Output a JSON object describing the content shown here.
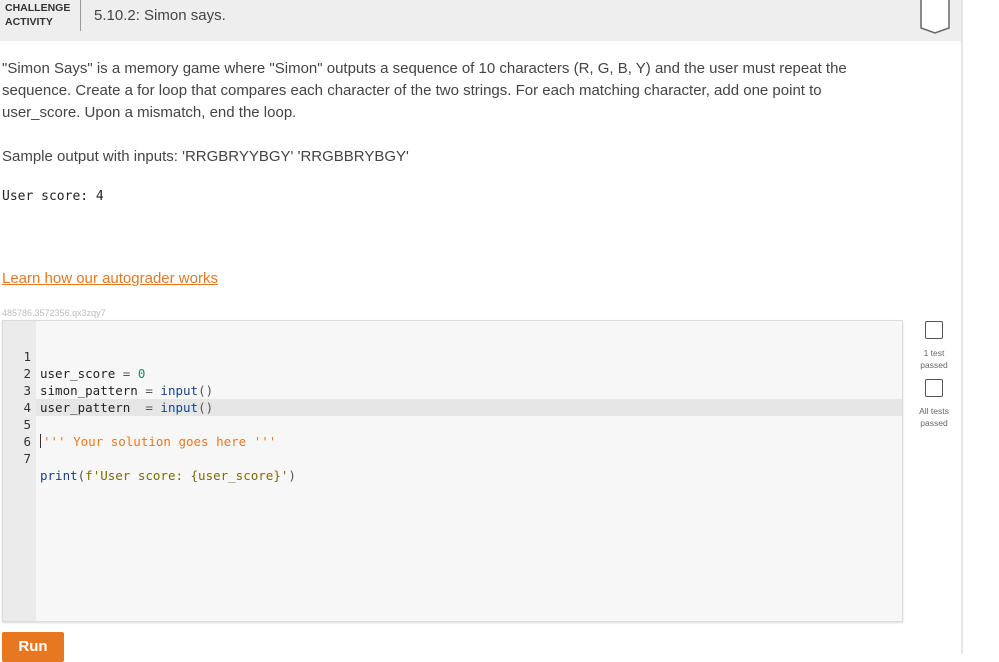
{
  "header": {
    "activity_type_line1": "CHALLENGE",
    "activity_type_line2": "ACTIVITY",
    "title": "5.10.2: Simon says."
  },
  "description": "\"Simon Says\" is a memory game where \"Simon\" outputs a sequence of 10 characters (R, G, B, Y) and the user must repeat the sequence. Create a for loop that compares each character of the two strings. For each matching character, add one point to user_score. Upon a mismatch, end the loop.",
  "sample": {
    "label": "Sample output with inputs: 'RRGBRYYBGY' 'RRGBBRYBGY'",
    "output": "User score: 4"
  },
  "learn_link": "Learn how our autograder works",
  "activity_id": "485786.3572356.qx3zqy7",
  "editor": {
    "line_numbers": [
      "1",
      "2",
      "3",
      "4",
      "5",
      "6",
      "7"
    ],
    "active_line": 5
  },
  "tests": {
    "test1_line1": "1 test",
    "test1_line2": "passed",
    "test2_line1": "All tests",
    "test2_line2": "passed"
  },
  "run_label": "Run",
  "colors": {
    "accent": "#e87722",
    "header_bg": "#eeeeee",
    "editor_bg": "#f7f7f7"
  }
}
